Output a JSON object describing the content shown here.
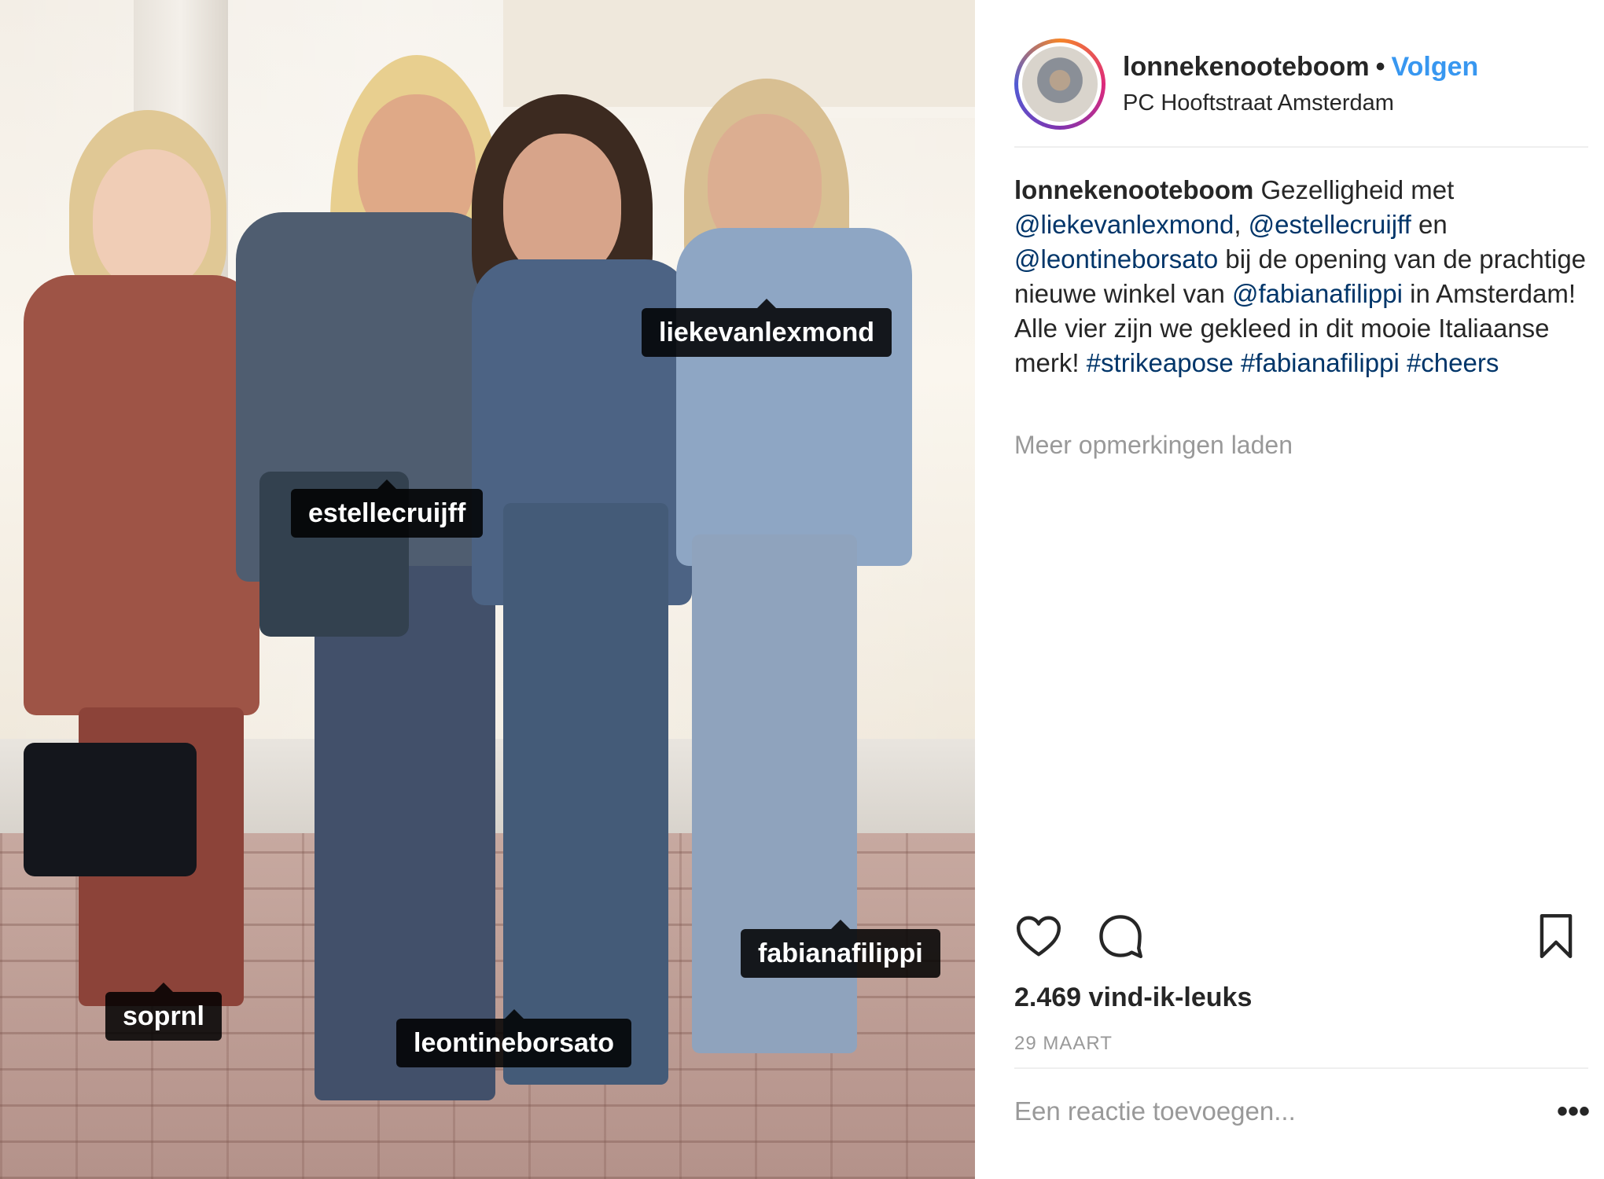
{
  "photo": {
    "tags": [
      {
        "label": "liekevanlexmond"
      },
      {
        "label": "estellecruijff"
      },
      {
        "label": "fabianafilippi"
      },
      {
        "label": "soprnl"
      },
      {
        "label": "leontineborsato"
      }
    ]
  },
  "header": {
    "username": "lonnekenooteboom",
    "separator": "•",
    "follow_label": "Volgen",
    "location": "PC Hooftstraat Amsterdam"
  },
  "caption": {
    "username": "lonnekenooteboom",
    "text_1": "Gezelligheid met",
    "mention_1": "@liekevanlexmond",
    "comma": ",",
    "mention_2": "@estellecruijff",
    "text_2": "en",
    "mention_3": "@leontineborsato",
    "text_3": "bij de opening van de prachtige nieuwe winkel van",
    "mention_4": "@fabianafilippi",
    "text_4": "in Amsterdam! Alle vier zijn we gekleed in dit mooie Italiaanse merk!",
    "hashtag_1": "#strikeapose",
    "hashtag_2": "#fabianafilippi",
    "hashtag_3": "#cheers"
  },
  "more_comments_label": "Meer opmerkingen laden",
  "likes_label": "2.469 vind-ik-leuks",
  "date_label": "29 MAART",
  "comment_box": {
    "placeholder": "Een reactie toevoegen...",
    "more_label": "•••"
  },
  "colors": {
    "link": "#003569",
    "follow": "#3897f0",
    "muted": "#999999"
  },
  "icons": {
    "like": "heart-icon",
    "comment": "speech-bubble-icon",
    "save": "bookmark-icon",
    "options": "more-options-icon"
  }
}
